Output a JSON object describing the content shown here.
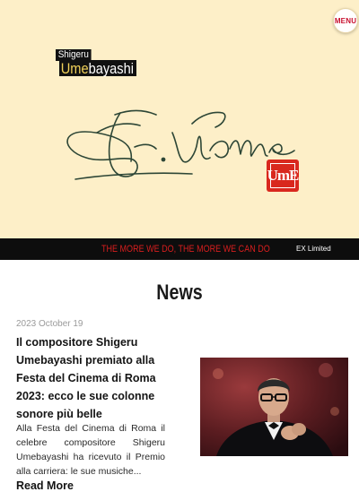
{
  "header": {
    "menu_label": "MENU",
    "logo": {
      "first_name": "Shigeru",
      "last_name_highlight": "Ume",
      "last_name_rest": "bayashi"
    },
    "signature_icon": "handwritten-signature",
    "seal_text": "UmE"
  },
  "banner": {
    "tagline": "THE MORE WE DO, THE MORE WE CAN DO",
    "ex_link": "EX Limited"
  },
  "news": {
    "heading": "News",
    "items": [
      {
        "date": "2023 October 19",
        "title": "Il compositore Shigeru Umebayashi premiato alla Festa del Cinema di Roma 2023: ecco le sue colonne sonore più belle",
        "excerpt": "Alla Festa del Cinema di Roma il celebre compositore Shigeru Umebayashi ha ricevuto il Premio alla carriera: le sue musiche...",
        "read_more": "Read More",
        "image": "photo-composer-red-carpet"
      }
    ]
  },
  "colors": {
    "hero_bg": "#fdefc8",
    "banner_bg": "#0d0d0d",
    "tagline": "#d81e1e",
    "seal": "#d9281e",
    "logo_highlight": "#f2d25a"
  }
}
